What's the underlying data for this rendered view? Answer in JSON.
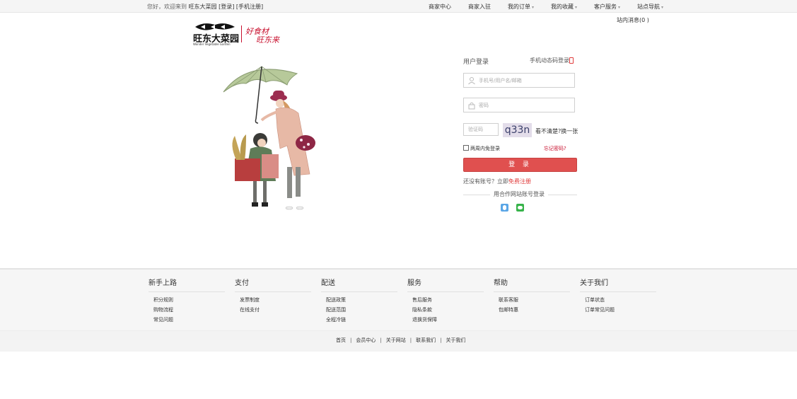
{
  "topbar": {
    "welcome_prefix": "您好，欢迎来到",
    "site_name": "旺东大菜园",
    "login": "[登录]",
    "register": "[手机注册]",
    "nav": [
      {
        "label": "商家中心",
        "dropdown": false
      },
      {
        "label": "商家入驻",
        "dropdown": false
      },
      {
        "label": "我的订单",
        "dropdown": true
      },
      {
        "label": "我的收藏",
        "dropdown": true
      },
      {
        "label": "客户服务",
        "dropdown": true
      },
      {
        "label": "站点导航",
        "dropdown": true
      }
    ],
    "messages": "站内消息(0 )"
  },
  "logo": {
    "brand_cn": "旺东大菜园",
    "brand_en": "Wonder Vegetable Garden",
    "slogan_line1": "好食材",
    "slogan_line2": "旺东来"
  },
  "login": {
    "title": "用户登录",
    "sms_login": "手机动态码登录",
    "username_placeholder": "手机号/用户名/邮箱",
    "password_placeholder": "密码",
    "captcha_placeholder": "验证码",
    "captcha_code": "q33n",
    "refresh_captcha": "看不清楚?换一张",
    "remember": "两周内免登录",
    "forgot": "忘记密码?",
    "submit": "登 录",
    "no_account": "还没有账号？立即",
    "register_link": "免费注册",
    "partner_login": "用合作网站账号登录"
  },
  "footer": {
    "columns": [
      {
        "title": "新手上路",
        "links": [
          "积分规则",
          "购物流程",
          "常见问题"
        ]
      },
      {
        "title": "支付",
        "links": [
          "发票制度",
          "在线支付"
        ]
      },
      {
        "title": "配送",
        "links": [
          "配送政策",
          "配送范围",
          "全程冷链"
        ]
      },
      {
        "title": "服务",
        "links": [
          "售后服务",
          "隐私条款",
          "退换货保障"
        ]
      },
      {
        "title": "帮助",
        "links": [
          "联系客服",
          "包邮特惠"
        ]
      },
      {
        "title": "关于我们",
        "links": [
          "订单状态",
          "订单常见问题"
        ]
      }
    ],
    "bottom_links": [
      "首页",
      "会员中心",
      "关于网站",
      "联系我们",
      "关于我们"
    ],
    "separator": "|"
  },
  "colors": {
    "accent": "#e0504f",
    "link_red": "#c8102e",
    "footer_bg": "#f6f6f6"
  }
}
